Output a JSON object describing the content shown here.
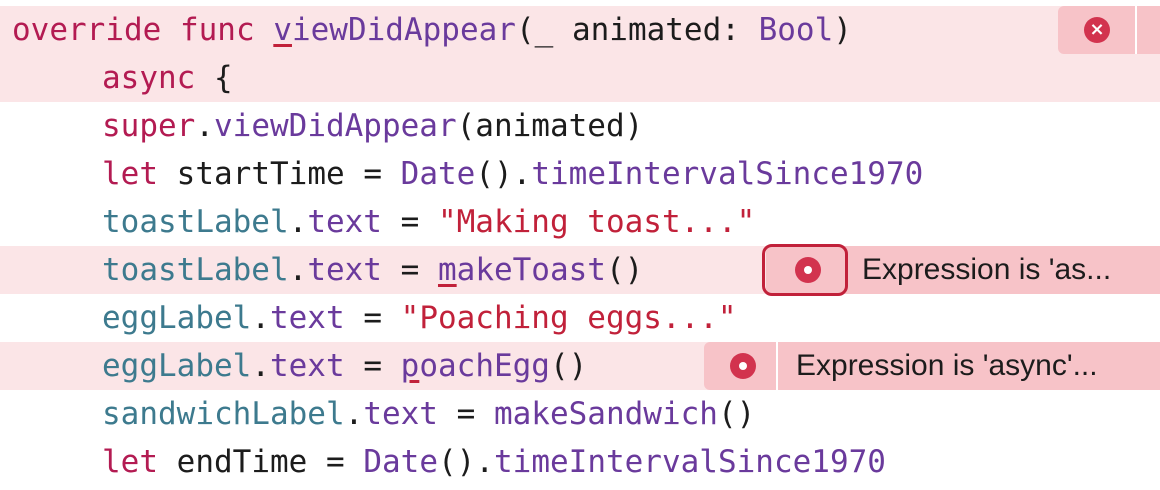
{
  "editor": {
    "lines": [
      {
        "tokens": [
          "override",
          "func",
          "v",
          "iewDidAppear",
          "(_",
          "animated",
          ":",
          "Bool",
          ")"
        ]
      },
      {
        "tokens": [
          "async",
          "{"
        ]
      },
      {
        "tokens": [
          "super",
          ".",
          "viewDidAppear",
          "(animated)"
        ]
      },
      {
        "tokens": [
          "let",
          "startTime",
          "=",
          "Date",
          "().",
          "timeIntervalSince1970"
        ]
      },
      {
        "tokens": [
          "toastLabel",
          ".",
          "text",
          "=",
          "\"Making toast...\""
        ]
      },
      {
        "tokens": [
          "toastLabel",
          ".",
          "text",
          "=",
          "m",
          "akeToast",
          "()"
        ]
      },
      {
        "tokens": [
          "eggLabel",
          ".",
          "text",
          "=",
          "\"Poaching eggs...\""
        ]
      },
      {
        "tokens": [
          "eggLabel",
          ".",
          "text",
          "=",
          "p",
          "oachEgg",
          "()"
        ]
      },
      {
        "tokens": [
          "sandwichLabel",
          ".",
          "text",
          "=",
          "makeSandwich",
          "()"
        ]
      },
      {
        "tokens": [
          "let",
          "endTime",
          "=",
          "Date",
          "().",
          "timeIntervalSince1970"
        ]
      }
    ]
  },
  "errors": {
    "line1_icon": "close-icon",
    "line6_message": "Expression is 'as...",
    "line8_message": "Expression is 'async'..."
  },
  "colors": {
    "error_line_bg": "#fbe5e7",
    "badge_bg": "#f7c3c8",
    "error_red": "#d2334e",
    "keyword": "#b31b52",
    "purple": "#6a3a9c",
    "teal": "#3d7a8e",
    "string": "#c1213a"
  }
}
